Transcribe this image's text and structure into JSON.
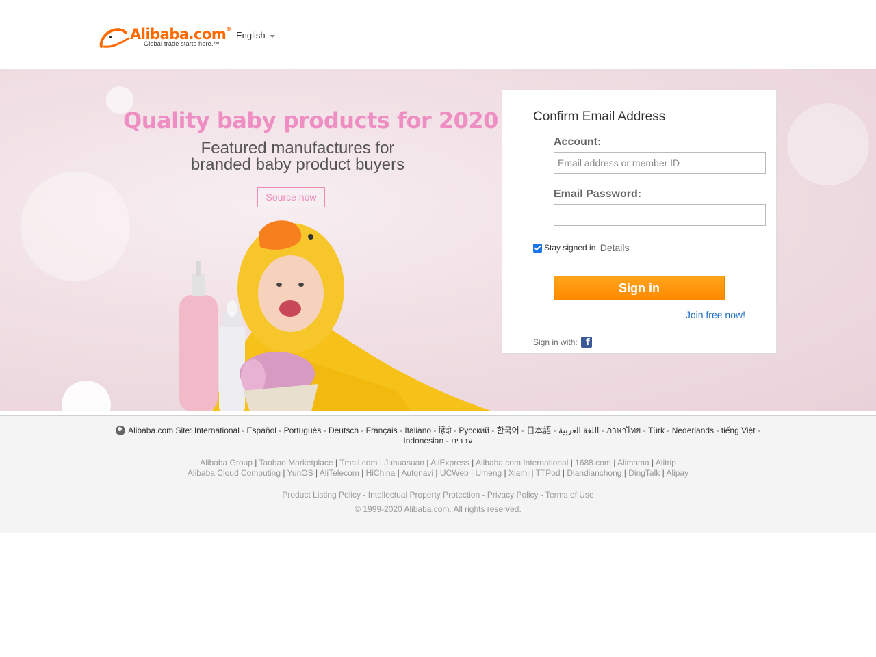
{
  "header": {
    "logo_wordmark": "Alibaba.com",
    "logo_tagline": "Global trade starts here.™",
    "language": "English"
  },
  "banner": {
    "title": "Quality baby products for 2020",
    "subtitle_line1": "Featured manufactures for",
    "subtitle_line2": "branded baby product buyers",
    "cta": "Source now"
  },
  "login": {
    "title": "Confirm Email Address",
    "account_label": "Account:",
    "account_placeholder": "Email address or member ID",
    "password_label": "Email Password:",
    "password_value": "",
    "stay_signed_in": "Stay signed in.",
    "stay_checked": true,
    "details": "Details",
    "signin_button": "Sign in",
    "join": "Join free now!",
    "signin_with": "Sign in with:"
  },
  "footer": {
    "site_label": "Alibaba.com Site:",
    "sites": [
      "International",
      "Español",
      "Português",
      "Deutsch",
      "Français",
      "Italiano",
      "हिंदी",
      "Русский",
      "한국어",
      "日本語",
      "اللغة العربية",
      "ภาษาไทย",
      "Türk",
      "Nederlands",
      "tiếng Việt",
      "Indonesian",
      "עברית"
    ],
    "group_row1": [
      "Alibaba Group",
      "Taobao Marketplace",
      "Tmall.com",
      "Juhuasuan",
      "AliExpress",
      "Alibaba.com International",
      "1688.com",
      "Alimama",
      "Alitrip"
    ],
    "group_row2": [
      "Alibaba Cloud Computing",
      "YunOS",
      "AliTelecom",
      "HiChina",
      "Autonavi",
      "UCWeb",
      "Umeng",
      "Xiami",
      "TTPod",
      "Diandianchong",
      "DingTalk",
      "Alipay"
    ],
    "policies": [
      "Product Listing Policy",
      "Intellectual Property Protection",
      "Privacy Policy",
      "Terms of Use"
    ],
    "copyright": "© 1999-2020 Alibaba.com. All rights reserved."
  },
  "colors": {
    "brand_orange": "#ff6a00",
    "banner_pink": "#ee8ec2",
    "link_blue": "#1b6ec2"
  }
}
